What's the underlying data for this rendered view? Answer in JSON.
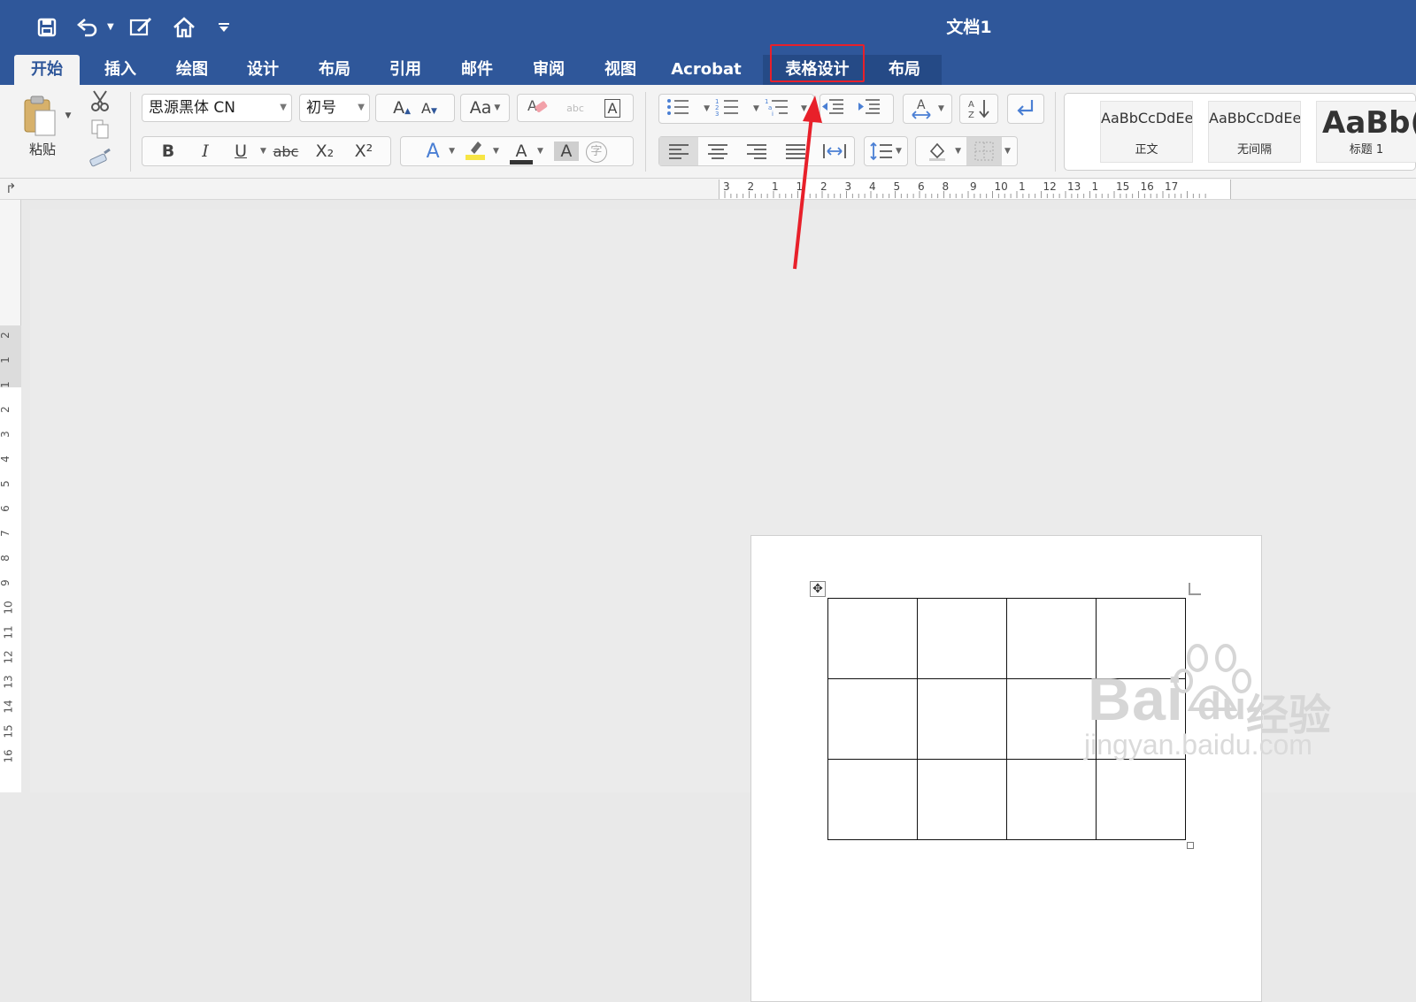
{
  "window": {
    "title": "文档1"
  },
  "quick_access": [
    {
      "icon": "save-icon"
    },
    {
      "icon": "undo-icon"
    },
    {
      "icon": "edit-icon"
    },
    {
      "icon": "home-icon"
    },
    {
      "icon": "customize-icon"
    }
  ],
  "tabs": [
    {
      "label": "开始",
      "active": true
    },
    {
      "label": "插入"
    },
    {
      "label": "绘图"
    },
    {
      "label": "设计"
    },
    {
      "label": "布局"
    },
    {
      "label": "引用"
    },
    {
      "label": "邮件"
    },
    {
      "label": "审阅"
    },
    {
      "label": "视图"
    },
    {
      "label": "Acrobat"
    },
    {
      "label": "表格设计",
      "contextual": true,
      "highlighted": true
    },
    {
      "label": "布局",
      "contextual": true
    }
  ],
  "clipboard": {
    "paste_label": "粘贴"
  },
  "font": {
    "name": "思源黑体 CN",
    "size": "初号"
  },
  "font_buttons": {
    "bold": "B",
    "italic": "I",
    "underline": "U",
    "strike": "abc",
    "subscript": "X₂",
    "superscript": "X²",
    "text_effect": "A",
    "font_color": "A",
    "char_shading": "A",
    "enclose": "字",
    "grow": "A",
    "shrink": "A",
    "case": "Aa",
    "phonetic": "abc",
    "char_border": "A"
  },
  "styles": [
    {
      "sample": "AaBbCcDdEe",
      "name": "正文"
    },
    {
      "sample": "AaBbCcDdEe",
      "name": "无间隔"
    },
    {
      "sample": "AaBb(",
      "name": "标题 1"
    }
  ],
  "ruler": {
    "h_numbers": [
      "3",
      "2",
      "1",
      "1",
      "2",
      "3",
      "4",
      "5",
      "6",
      "8",
      "9",
      "10",
      "1",
      "12",
      "13",
      "1",
      "15",
      "16",
      "17"
    ],
    "v_numbers": [
      "2",
      "1",
      "1",
      "2",
      "3",
      "4",
      "5",
      "6",
      "7",
      "8",
      "9",
      "10",
      "11",
      "12",
      "13",
      "14",
      "15",
      "16"
    ]
  },
  "document": {
    "table": {
      "rows": 3,
      "cols": 4
    }
  },
  "watermark": {
    "main": "Bai",
    "suffix": "du",
    "cn": "经验",
    "url": "jingyan.baidu.com"
  },
  "colors": {
    "title_bar": "#2f579a",
    "highlight": "#e8202a",
    "arrow": "#e8202a"
  }
}
